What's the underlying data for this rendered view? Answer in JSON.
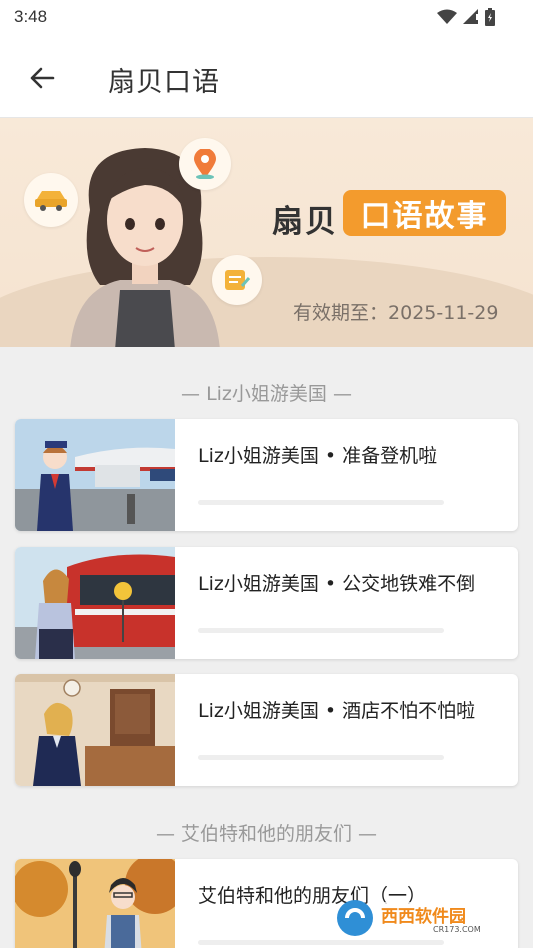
{
  "status_bar": {
    "time": "3:48"
  },
  "app_bar": {
    "title": "扇贝口语"
  },
  "banner": {
    "brand_left": "扇贝",
    "brand_pill": "口语故事",
    "validity_label": "有效期至：",
    "validity_date": "2025-11-29"
  },
  "sections": [
    {
      "title": "— Liz小姐游美国 —",
      "lessons": [
        {
          "title": "Liz小姐游美国 • 准备登机啦"
        },
        {
          "title": "Liz小姐游美国 • 公交地铁难不倒"
        },
        {
          "title": "Liz小姐游美国 • 酒店不怕不怕啦"
        }
      ]
    },
    {
      "title": "— 艾伯特和他的朋友们 —",
      "lessons": [
        {
          "title": "艾伯特和他的朋友们（一）"
        }
      ]
    }
  ],
  "watermark": {
    "text": "西西软件园",
    "sub": "CR173.COM"
  },
  "colors": {
    "accent": "#f39b2d",
    "banner_bg": "#f8e9d8",
    "page_bg": "#efefef"
  }
}
